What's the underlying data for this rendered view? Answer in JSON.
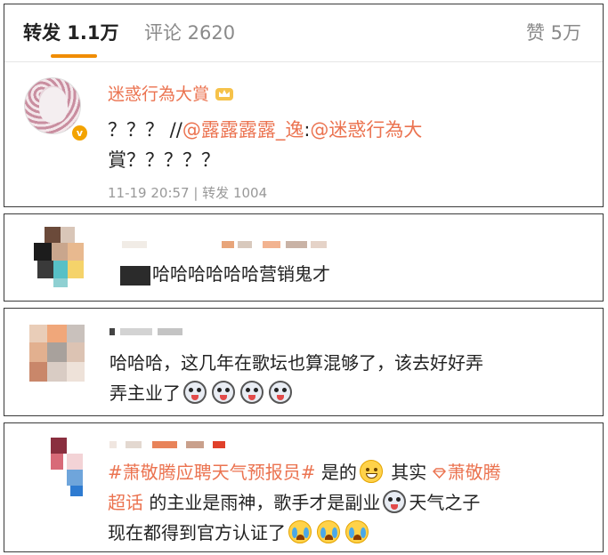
{
  "tabs": {
    "repost": "转发 1.1万",
    "comment": "评论 2620",
    "like": "赞 5万"
  },
  "post": {
    "username": "迷惑行為大賞",
    "text_prefix": "？？？ //",
    "mention1": "@露露露露_逸",
    "text_mid": ":",
    "mention2": "@迷惑行為大",
    "line2": "賞？？？？？",
    "meta": "11-19 20:57 | 转发 1004"
  },
  "comments": [
    {
      "text": "哈哈哈哈哈哈营销鬼才"
    },
    {
      "text_line1": "哈哈哈，这几年在歌坛也算混够了，该去好好弄",
      "text_line2": "弄主业了"
    },
    {
      "topic": "#萧敬腾应聘天气预报员#",
      "seg1": " 是的",
      "seg2": " 其实",
      "super_topic": "萧敬腾",
      "super_topic_2": "超话",
      "seg3": " 的主业是雨神，歌手才是副业",
      "seg4": "天气之子",
      "line3": "现在都得到官方认证了"
    }
  ],
  "colors": {
    "accent": "#eb7350",
    "tab_underline": "#f08c00",
    "muted": "#999999"
  }
}
